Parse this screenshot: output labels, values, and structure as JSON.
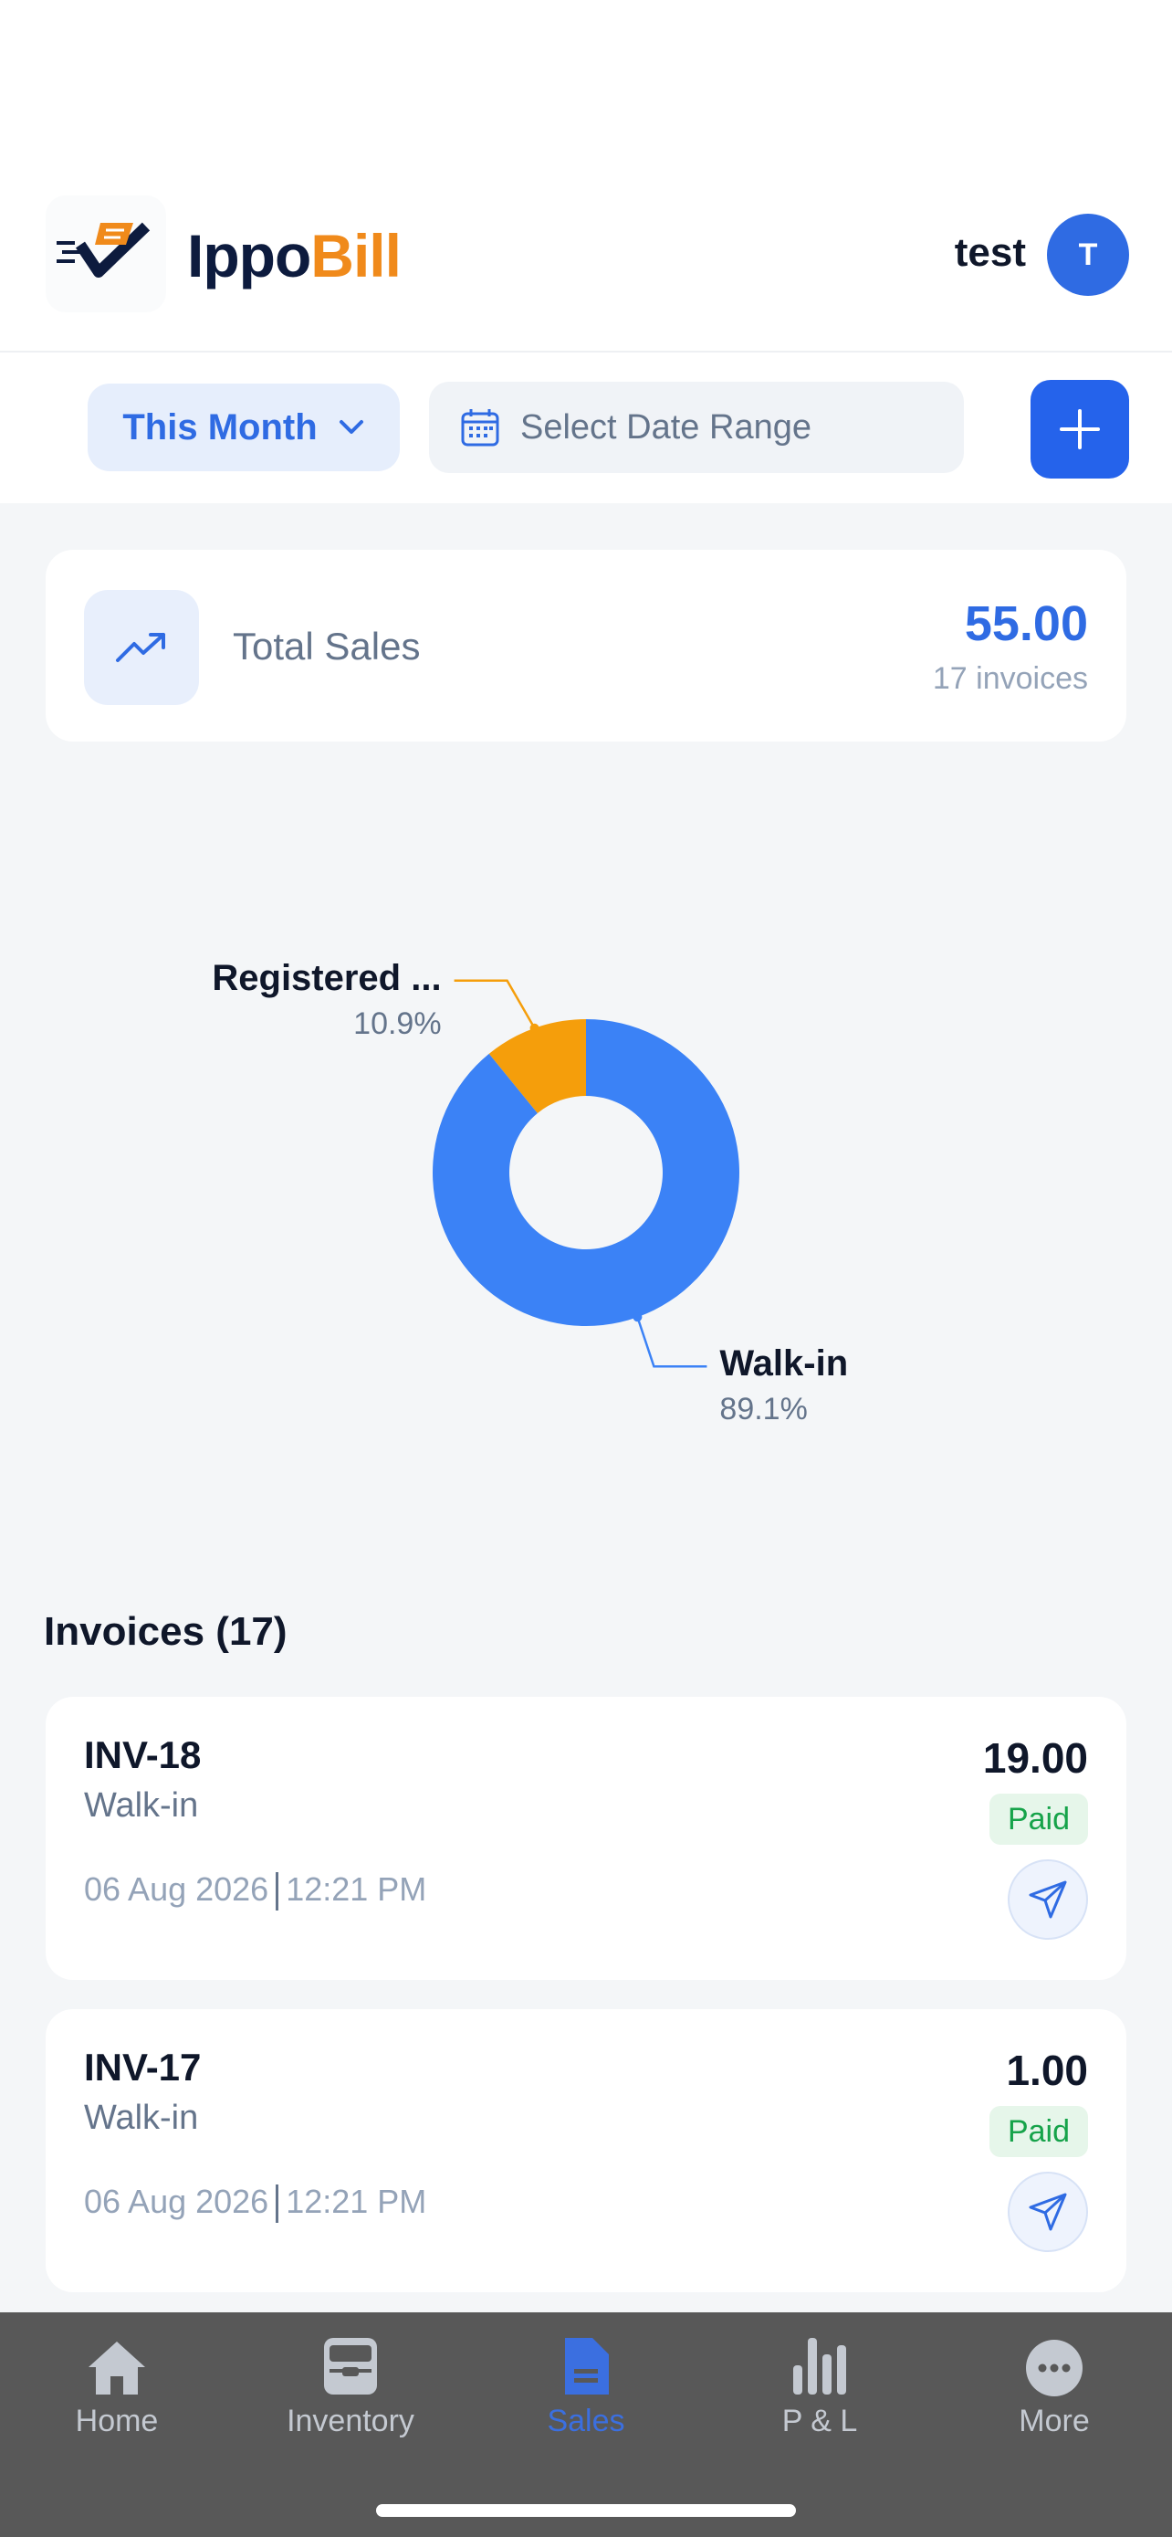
{
  "header": {
    "brand_part1": "Ippo",
    "brand_part2": "Bill",
    "username": "test",
    "avatar_initial": "T"
  },
  "filters": {
    "period": "This Month",
    "date_range_placeholder": "Select Date Range"
  },
  "summary": {
    "label": "Total Sales",
    "amount": "55.00",
    "count": "17 invoices"
  },
  "chart_data": {
    "type": "pie",
    "categories": [
      "Registered ...",
      "Walk-in"
    ],
    "values": [
      10.9,
      89.1
    ],
    "labels": [
      "10.9%",
      "89.1%"
    ],
    "colors": [
      "#f59e0b",
      "#3b82f6"
    ]
  },
  "invoices": {
    "title": "Invoices (17)",
    "items": [
      {
        "number": "INV-18",
        "customer": "Walk-in",
        "date": "06 Aug 2026",
        "time": "12:21 PM",
        "amount": "19.00",
        "status": "Paid"
      },
      {
        "number": "INV-17",
        "customer": "Walk-in",
        "date": "06 Aug 2026",
        "time": "12:21 PM",
        "amount": "1.00",
        "status": "Paid"
      }
    ]
  },
  "tabs": [
    {
      "label": "Home",
      "icon": "home-icon",
      "active": false
    },
    {
      "label": "Inventory",
      "icon": "inventory-icon",
      "active": false
    },
    {
      "label": "Sales",
      "icon": "document-icon",
      "active": true
    },
    {
      "label": "P & L",
      "icon": "bar-chart-icon",
      "active": false
    },
    {
      "label": "More",
      "icon": "more-icon",
      "active": false
    }
  ]
}
